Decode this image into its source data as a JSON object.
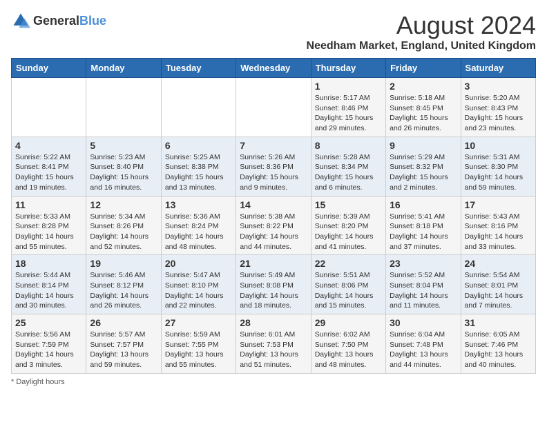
{
  "header": {
    "logo_general": "General",
    "logo_blue": "Blue",
    "month_year": "August 2024",
    "location": "Needham Market, England, United Kingdom"
  },
  "days_of_week": [
    "Sunday",
    "Monday",
    "Tuesday",
    "Wednesday",
    "Thursday",
    "Friday",
    "Saturday"
  ],
  "footer": {
    "note": "Daylight hours"
  },
  "weeks": [
    [
      {
        "day": "",
        "data": ""
      },
      {
        "day": "",
        "data": ""
      },
      {
        "day": "",
        "data": ""
      },
      {
        "day": "",
        "data": ""
      },
      {
        "day": "1",
        "sunrise": "Sunrise: 5:17 AM",
        "sunset": "Sunset: 8:46 PM",
        "daylight": "Daylight: 15 hours and 29 minutes."
      },
      {
        "day": "2",
        "sunrise": "Sunrise: 5:18 AM",
        "sunset": "Sunset: 8:45 PM",
        "daylight": "Daylight: 15 hours and 26 minutes."
      },
      {
        "day": "3",
        "sunrise": "Sunrise: 5:20 AM",
        "sunset": "Sunset: 8:43 PM",
        "daylight": "Daylight: 15 hours and 23 minutes."
      }
    ],
    [
      {
        "day": "4",
        "sunrise": "Sunrise: 5:22 AM",
        "sunset": "Sunset: 8:41 PM",
        "daylight": "Daylight: 15 hours and 19 minutes."
      },
      {
        "day": "5",
        "sunrise": "Sunrise: 5:23 AM",
        "sunset": "Sunset: 8:40 PM",
        "daylight": "Daylight: 15 hours and 16 minutes."
      },
      {
        "day": "6",
        "sunrise": "Sunrise: 5:25 AM",
        "sunset": "Sunset: 8:38 PM",
        "daylight": "Daylight: 15 hours and 13 minutes."
      },
      {
        "day": "7",
        "sunrise": "Sunrise: 5:26 AM",
        "sunset": "Sunset: 8:36 PM",
        "daylight": "Daylight: 15 hours and 9 minutes."
      },
      {
        "day": "8",
        "sunrise": "Sunrise: 5:28 AM",
        "sunset": "Sunset: 8:34 PM",
        "daylight": "Daylight: 15 hours and 6 minutes."
      },
      {
        "day": "9",
        "sunrise": "Sunrise: 5:29 AM",
        "sunset": "Sunset: 8:32 PM",
        "daylight": "Daylight: 15 hours and 2 minutes."
      },
      {
        "day": "10",
        "sunrise": "Sunrise: 5:31 AM",
        "sunset": "Sunset: 8:30 PM",
        "daylight": "Daylight: 14 hours and 59 minutes."
      }
    ],
    [
      {
        "day": "11",
        "sunrise": "Sunrise: 5:33 AM",
        "sunset": "Sunset: 8:28 PM",
        "daylight": "Daylight: 14 hours and 55 minutes."
      },
      {
        "day": "12",
        "sunrise": "Sunrise: 5:34 AM",
        "sunset": "Sunset: 8:26 PM",
        "daylight": "Daylight: 14 hours and 52 minutes."
      },
      {
        "day": "13",
        "sunrise": "Sunrise: 5:36 AM",
        "sunset": "Sunset: 8:24 PM",
        "daylight": "Daylight: 14 hours and 48 minutes."
      },
      {
        "day": "14",
        "sunrise": "Sunrise: 5:38 AM",
        "sunset": "Sunset: 8:22 PM",
        "daylight": "Daylight: 14 hours and 44 minutes."
      },
      {
        "day": "15",
        "sunrise": "Sunrise: 5:39 AM",
        "sunset": "Sunset: 8:20 PM",
        "daylight": "Daylight: 14 hours and 41 minutes."
      },
      {
        "day": "16",
        "sunrise": "Sunrise: 5:41 AM",
        "sunset": "Sunset: 8:18 PM",
        "daylight": "Daylight: 14 hours and 37 minutes."
      },
      {
        "day": "17",
        "sunrise": "Sunrise: 5:43 AM",
        "sunset": "Sunset: 8:16 PM",
        "daylight": "Daylight: 14 hours and 33 minutes."
      }
    ],
    [
      {
        "day": "18",
        "sunrise": "Sunrise: 5:44 AM",
        "sunset": "Sunset: 8:14 PM",
        "daylight": "Daylight: 14 hours and 30 minutes."
      },
      {
        "day": "19",
        "sunrise": "Sunrise: 5:46 AM",
        "sunset": "Sunset: 8:12 PM",
        "daylight": "Daylight: 14 hours and 26 minutes."
      },
      {
        "day": "20",
        "sunrise": "Sunrise: 5:47 AM",
        "sunset": "Sunset: 8:10 PM",
        "daylight": "Daylight: 14 hours and 22 minutes."
      },
      {
        "day": "21",
        "sunrise": "Sunrise: 5:49 AM",
        "sunset": "Sunset: 8:08 PM",
        "daylight": "Daylight: 14 hours and 18 minutes."
      },
      {
        "day": "22",
        "sunrise": "Sunrise: 5:51 AM",
        "sunset": "Sunset: 8:06 PM",
        "daylight": "Daylight: 14 hours and 15 minutes."
      },
      {
        "day": "23",
        "sunrise": "Sunrise: 5:52 AM",
        "sunset": "Sunset: 8:04 PM",
        "daylight": "Daylight: 14 hours and 11 minutes."
      },
      {
        "day": "24",
        "sunrise": "Sunrise: 5:54 AM",
        "sunset": "Sunset: 8:01 PM",
        "daylight": "Daylight: 14 hours and 7 minutes."
      }
    ],
    [
      {
        "day": "25",
        "sunrise": "Sunrise: 5:56 AM",
        "sunset": "Sunset: 7:59 PM",
        "daylight": "Daylight: 14 hours and 3 minutes."
      },
      {
        "day": "26",
        "sunrise": "Sunrise: 5:57 AM",
        "sunset": "Sunset: 7:57 PM",
        "daylight": "Daylight: 13 hours and 59 minutes."
      },
      {
        "day": "27",
        "sunrise": "Sunrise: 5:59 AM",
        "sunset": "Sunset: 7:55 PM",
        "daylight": "Daylight: 13 hours and 55 minutes."
      },
      {
        "day": "28",
        "sunrise": "Sunrise: 6:01 AM",
        "sunset": "Sunset: 7:53 PM",
        "daylight": "Daylight: 13 hours and 51 minutes."
      },
      {
        "day": "29",
        "sunrise": "Sunrise: 6:02 AM",
        "sunset": "Sunset: 7:50 PM",
        "daylight": "Daylight: 13 hours and 48 minutes."
      },
      {
        "day": "30",
        "sunrise": "Sunrise: 6:04 AM",
        "sunset": "Sunset: 7:48 PM",
        "daylight": "Daylight: 13 hours and 44 minutes."
      },
      {
        "day": "31",
        "sunrise": "Sunrise: 6:05 AM",
        "sunset": "Sunset: 7:46 PM",
        "daylight": "Daylight: 13 hours and 40 minutes."
      }
    ]
  ]
}
